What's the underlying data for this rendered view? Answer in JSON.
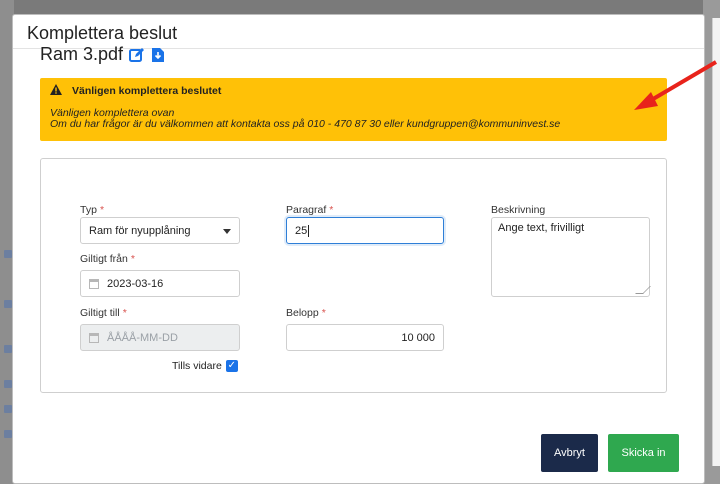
{
  "modal": {
    "title": "Komplettera beslut",
    "file_name": "Ram 3.pdf"
  },
  "alert": {
    "heading": "Vänligen komplettera beslutet",
    "line1": "Vänligen komplettera ovan",
    "line2": "Om du har frågor är du välkommen att kontakta oss på 010 - 470 87 30 eller kundgruppen@kommuninvest.se"
  },
  "form": {
    "typ_label": "Typ",
    "typ_value": "Ram för nyupplåning",
    "giltigt_fran_label": "Giltigt från",
    "giltigt_fran_value": "2023-03-16",
    "giltigt_till_label": "Giltigt till",
    "giltigt_till_placeholder": "ÅÅÅÅ-MM-DD",
    "tills_vidare_label": "Tills vidare",
    "tills_vidare_checked": true,
    "paragraf_label": "Paragraf",
    "paragraf_value": "25",
    "belopp_label": "Belopp",
    "belopp_value": "10 000",
    "beskrivning_label": "Beskrivning",
    "beskrivning_placeholder": "Ange text, frivilligt",
    "required_marker": "*"
  },
  "buttons": {
    "cancel": "Avbryt",
    "submit": "Skicka in"
  },
  "colors": {
    "alert_bg": "#ffc107",
    "cancel_bg": "#1b2a4a",
    "submit_bg": "#2fa84f",
    "accent": "#1a73e8",
    "annotation_arrow": "#e8231b"
  },
  "icons": [
    "edit-icon",
    "download-icon",
    "warning-icon",
    "calendar-icon",
    "chevron-down-icon",
    "checkmark-icon"
  ]
}
